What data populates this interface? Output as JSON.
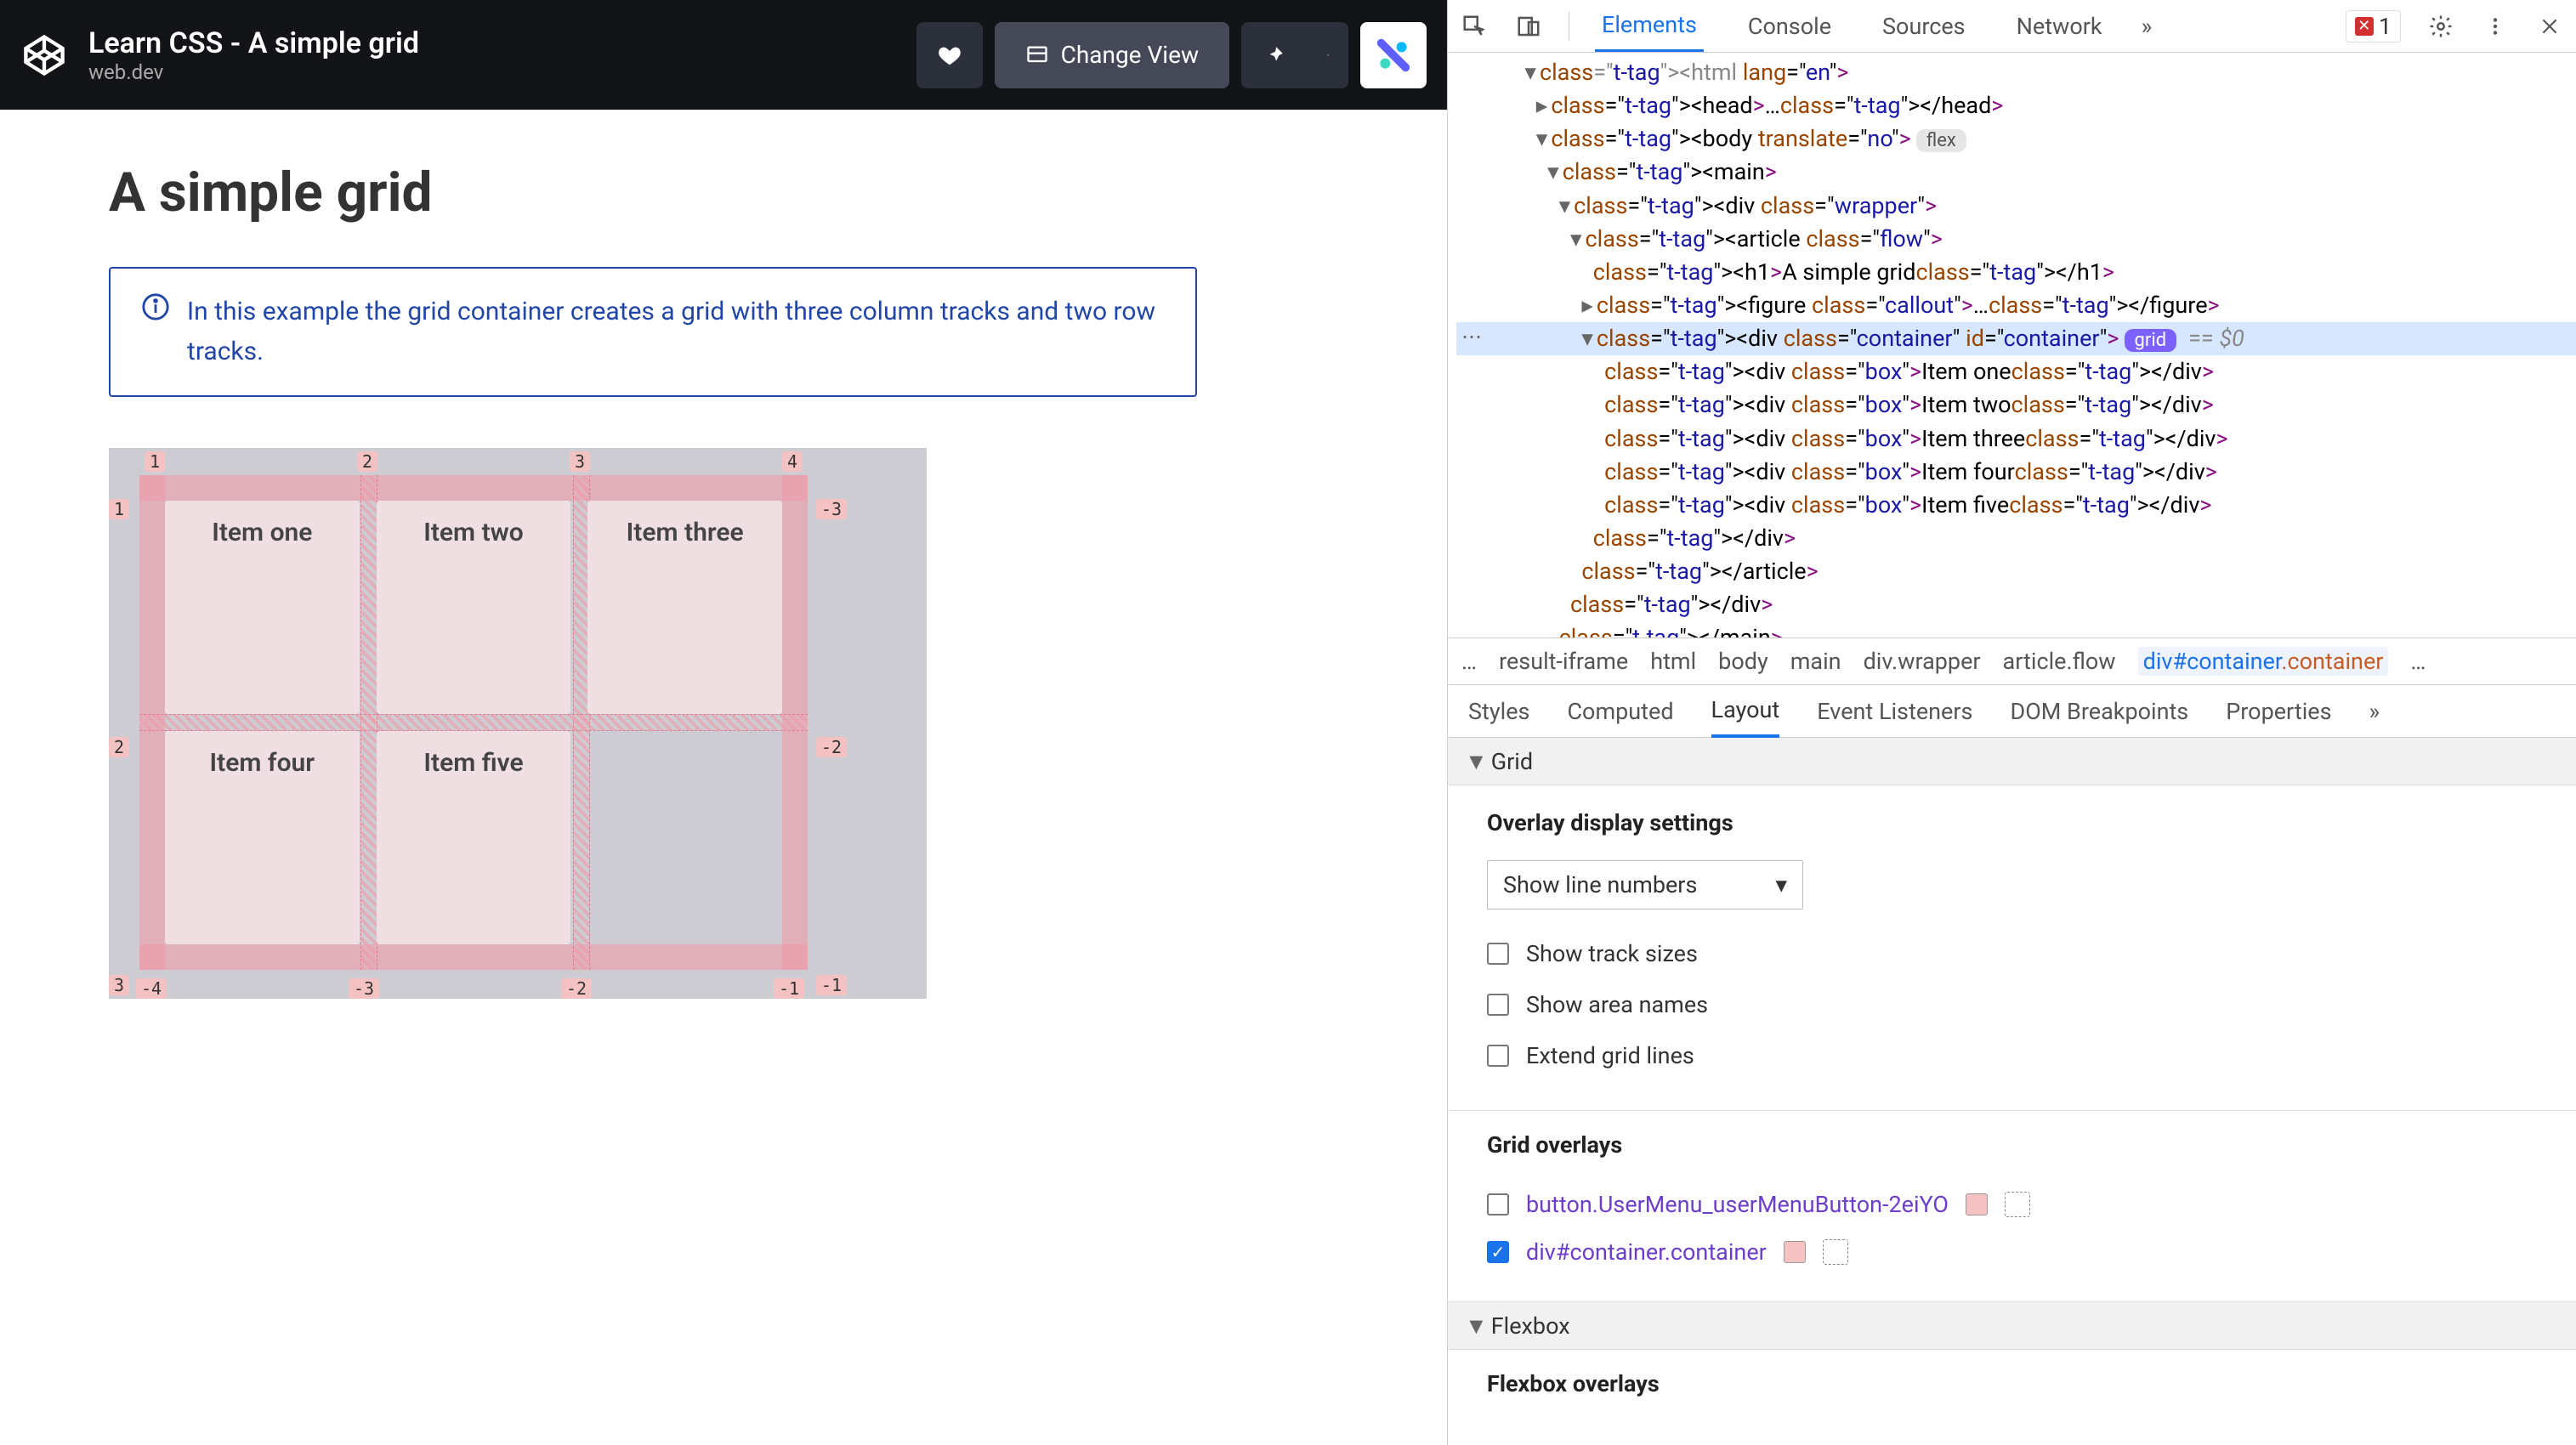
{
  "header": {
    "title": "Learn CSS - A simple grid",
    "subtitle": "web.dev",
    "change_view": "Change View"
  },
  "page": {
    "h1": "A simple grid",
    "callout": "In this example the grid container creates a grid with three column tracks and two row tracks."
  },
  "grid_demo": {
    "items": [
      "Item one",
      "Item two",
      "Item three",
      "Item four",
      "Item five"
    ],
    "col_labels_top": [
      "1",
      "2",
      "3",
      "4"
    ],
    "row_labels_left": [
      "1",
      "2",
      "3"
    ],
    "col_labels_bottom": [
      "-4",
      "-3",
      "-2",
      "-1"
    ],
    "row_labels_right": [
      "-3",
      "-2",
      "-1"
    ]
  },
  "devtools": {
    "tabs": [
      "Elements",
      "Console",
      "Sources",
      "Network"
    ],
    "more": "»",
    "error_count": "1",
    "dom": [
      {
        "indent": 12,
        "arrow": "▾",
        "html": "<html lang=\"en\">",
        "dim": true
      },
      {
        "indent": 14,
        "arrow": "▸",
        "html": "<head>…</head>"
      },
      {
        "indent": 14,
        "arrow": "▾",
        "html": "<body translate=\"no\">",
        "badge": "flex"
      },
      {
        "indent": 16,
        "arrow": "▾",
        "html": "<main>"
      },
      {
        "indent": 18,
        "arrow": "▾",
        "html": "<div class=\"wrapper\">"
      },
      {
        "indent": 20,
        "arrow": "▾",
        "html": "<article class=\"flow\">"
      },
      {
        "indent": 22,
        "arrow": "",
        "html": "<h1>A simple grid</h1>"
      },
      {
        "indent": 22,
        "arrow": "▸",
        "html": "<figure class=\"callout\">…</figure>"
      },
      {
        "indent": 22,
        "arrow": "▾",
        "html": "<div class=\"container\" id=\"container\">",
        "badge": "grid",
        "sel": true,
        "eq": "== $0"
      },
      {
        "indent": 24,
        "arrow": "",
        "html": "<div class=\"box\">Item one</div>"
      },
      {
        "indent": 24,
        "arrow": "",
        "html": "<div class=\"box\">Item two</div>"
      },
      {
        "indent": 24,
        "arrow": "",
        "html": "<div class=\"box\">Item three</div>"
      },
      {
        "indent": 24,
        "arrow": "",
        "html": "<div class=\"box\">Item four</div>"
      },
      {
        "indent": 24,
        "arrow": "",
        "html": "<div class=\"box\">Item five</div>"
      },
      {
        "indent": 22,
        "arrow": "",
        "html": "</div>"
      },
      {
        "indent": 20,
        "arrow": "",
        "html": "</article>"
      },
      {
        "indent": 18,
        "arrow": "",
        "html": "</div>"
      },
      {
        "indent": 16,
        "arrow": "",
        "html": "</main>"
      }
    ],
    "crumbs": [
      "…",
      "result-iframe",
      "html",
      "body",
      "main",
      "div.wrapper",
      "article.flow",
      "div#container.container"
    ],
    "subtabs": [
      "Styles",
      "Computed",
      "Layout",
      "Event Listeners",
      "DOM Breakpoints",
      "Properties"
    ],
    "subtabs_more": "»",
    "section_grid": "Grid",
    "overlay_heading": "Overlay display settings",
    "overlay_select": "Show line numbers",
    "overlay_checks": [
      "Show track sizes",
      "Show area names",
      "Extend grid lines"
    ],
    "grid_overlays_heading": "Grid overlays",
    "grid_overlays": [
      {
        "name": "button.UserMenu_userMenuButton-2eiYO",
        "on": false
      },
      {
        "name": "div#container.container",
        "on": true
      }
    ],
    "section_flexbox": "Flexbox",
    "flexbox_overlays_heading": "Flexbox overlays"
  }
}
